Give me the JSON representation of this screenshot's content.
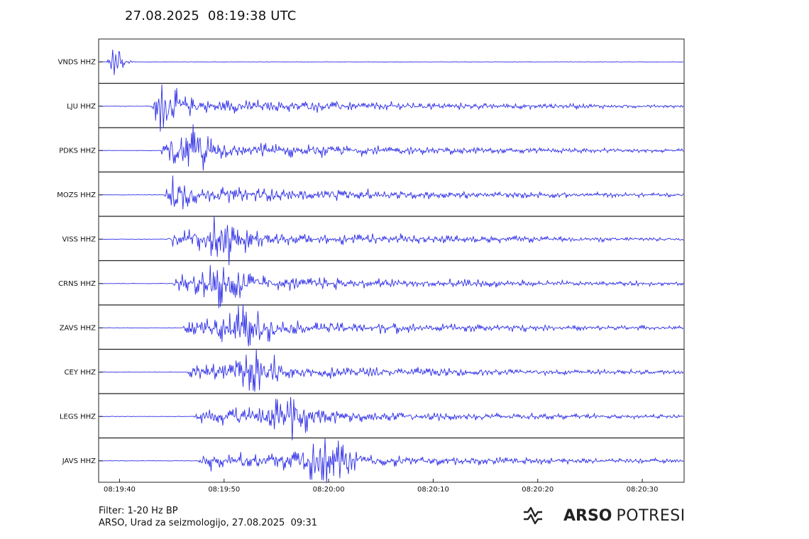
{
  "header": {
    "title": "27.08.2025  08:19:38 UTC"
  },
  "footer": {
    "filter": "Filter: 1-20 Hz BP",
    "source": "ARSO, Urad za seizmologijo, 27.08.2025  09:31"
  },
  "logo": {
    "brand_bold": "ARSO",
    "brand_light": "POTRESI",
    "mark_icon": "seismic-wave-logo-icon"
  },
  "chart_data": {
    "type": "line",
    "chart_kind": "seismogram record section",
    "trace_color": "#2f2fe6",
    "x_unit": "time (UTC)",
    "x_range": [
      "08:19:38",
      "08:20:34"
    ],
    "x_ticks": [
      "08:19:40",
      "08:19:50",
      "08:20:00",
      "08:20:10",
      "08:20:20",
      "08:20:30"
    ],
    "grid": false,
    "legend": "none",
    "series": [
      {
        "name": "VNDS HHZ",
        "onset": "08:19:38.7",
        "peak_time": "08:19:40.0",
        "peak_amp": 1.0,
        "coda_end": "08:19:41.5"
      },
      {
        "name": "LJU HHZ",
        "onset": "08:19:43.0",
        "peak_time": "08:19:44.0",
        "peak_amp": 0.95,
        "coda_end": "08:20:34"
      },
      {
        "name": "PDKS HHZ",
        "onset": "08:19:43.8",
        "peak_time": "08:19:47.0",
        "peak_amp": 1.0,
        "coda_end": "08:20:34"
      },
      {
        "name": "MOZS HHZ",
        "onset": "08:19:44.3",
        "peak_time": "08:19:44.3",
        "peak_amp": 1.0,
        "coda_end": "08:20:34"
      },
      {
        "name": "VISS HHZ",
        "onset": "08:19:44.5",
        "peak_time": "08:19:50.0",
        "peak_amp": 1.0,
        "coda_end": "08:20:34"
      },
      {
        "name": "CRNS HHZ",
        "onset": "08:19:45.0",
        "peak_time": "08:19:50.0",
        "peak_amp": 1.0,
        "coda_end": "08:20:34"
      },
      {
        "name": "ZAVS HHZ",
        "onset": "08:19:46.0",
        "peak_time": "08:19:52.0",
        "peak_amp": 1.0,
        "coda_end": "08:20:34"
      },
      {
        "name": "CEY HHZ",
        "onset": "08:19:46.5",
        "peak_time": "08:19:53.0",
        "peak_amp": 1.0,
        "coda_end": "08:20:34"
      },
      {
        "name": "LEGS HHZ",
        "onset": "08:19:47.0",
        "peak_time": "08:19:56.0",
        "peak_amp": 1.0,
        "coda_end": "08:20:34"
      },
      {
        "name": "JAVS HHZ",
        "onset": "08:19:47.5",
        "peak_time": "08:20:00.0",
        "peak_amp": 1.0,
        "coda_end": "08:20:34"
      }
    ]
  }
}
